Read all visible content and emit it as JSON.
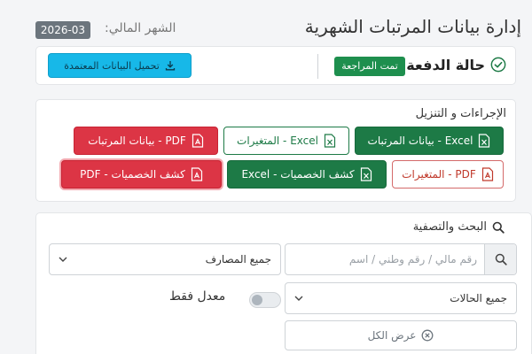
{
  "header": {
    "title": "إدارة بيانات المرتبات الشهرية",
    "month_label": "الشهر المالي:",
    "month_value": "2026-03"
  },
  "payment": {
    "label": "حالة الدفعة:",
    "status": "تمت المراجعة",
    "download_label": "تحميل البيانات المعتمدة"
  },
  "actions": {
    "title": "الإجراءات و التنزيل",
    "buttons": [
      {
        "label": "Excel - بيانات المرتبات",
        "icon": "excel-file-icon"
      },
      {
        "label": "Excel - المتغيرات",
        "icon": "excel-file-icon"
      },
      {
        "label": "PDF - بيانات المرتبات",
        "icon": "pdf-file-icon"
      },
      {
        "label": "PDF - المتغيرات",
        "icon": "pdf-file-icon"
      },
      {
        "label": "كشف الخصميات - Excel",
        "icon": "excel-file-icon"
      },
      {
        "label": "كشف الخصميات - PDF",
        "icon": "pdf-file-icon"
      }
    ]
  },
  "search": {
    "title": "البحث والتصفية",
    "placeholder": "رقم مالي / رقم وطني / اسم",
    "bank_select": "جميع المصارف",
    "status_select": "جميع الحالات",
    "adjusted_only": "معدل فقط",
    "show_all": "عرض الكل"
  },
  "colors": {
    "success": "#1d7a46",
    "danger": "#dc3545",
    "info": "#17b8e8",
    "secondary": "#6c757d"
  }
}
